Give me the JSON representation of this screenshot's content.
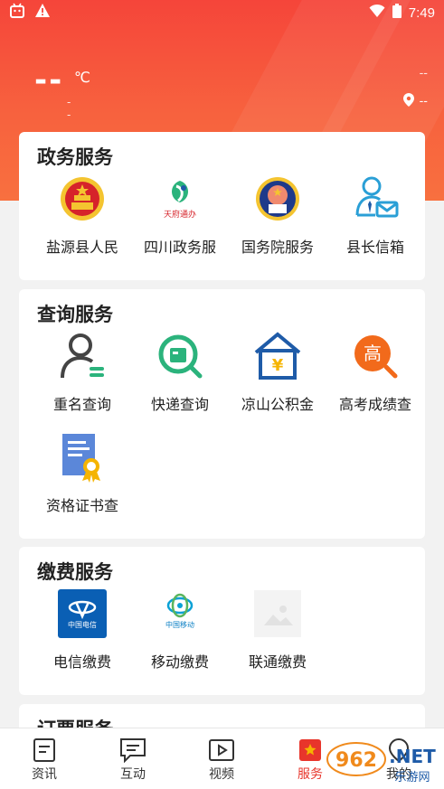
{
  "status_bar": {
    "time": "7:49"
  },
  "weather": {
    "temp": "--",
    "unit": "℃",
    "desc": "--"
  },
  "location": {
    "top": "--",
    "city": "--"
  },
  "sections": [
    {
      "title": "政务服务",
      "items": [
        {
          "label": "盐源县人民",
          "icon": "national-emblem-icon"
        },
        {
          "label": "四川政务服",
          "icon": "tianfu-tongban-icon"
        },
        {
          "label": "国务院服务",
          "icon": "state-council-icon"
        },
        {
          "label": "县长信箱",
          "icon": "mailbox-icon"
        }
      ]
    },
    {
      "title": "查询服务",
      "items": [
        {
          "label": "重名查询",
          "icon": "person-icon"
        },
        {
          "label": "快递查询",
          "icon": "express-icon"
        },
        {
          "label": "凉山公积金",
          "icon": "housing-fund-icon"
        },
        {
          "label": "高考成绩查",
          "icon": "exam-score-icon"
        },
        {
          "label": "资格证书查",
          "icon": "certificate-icon"
        }
      ]
    },
    {
      "title": "缴费服务",
      "items": [
        {
          "label": "电信缴费",
          "icon": "china-telecom-icon"
        },
        {
          "label": "移动缴费",
          "icon": "china-mobile-icon"
        },
        {
          "label": "联通缴费",
          "icon": "image-placeholder-icon"
        }
      ]
    },
    {
      "title": "订票服务",
      "items": []
    }
  ],
  "logos": {
    "tianfu": "天府通办",
    "telecom": "中国电信",
    "mobile": "中国移动",
    "exam": "高",
    "fund": "¥"
  },
  "tabs": [
    {
      "label": "资讯",
      "icon": "news-icon",
      "active": false
    },
    {
      "label": "互动",
      "icon": "chat-icon",
      "active": false
    },
    {
      "label": "视频",
      "icon": "video-icon",
      "active": false
    },
    {
      "label": "服务",
      "icon": "service-icon",
      "active": true
    },
    {
      "label": "我的",
      "icon": "profile-icon",
      "active": false
    }
  ],
  "watermark": {
    "text_big": "962",
    "text_net": ".NET",
    "text_sub": "乐游网"
  },
  "colors": {
    "primary": "#f5453a",
    "active_tab": "#e8352b",
    "telecom_blue": "#0a5fb4",
    "fund_blue": "#1e5ba8",
    "exam_orange": "#f26a1b",
    "express_green": "#2bb37c",
    "cert_blue": "#5b87d9",
    "cert_gold": "#f5b400"
  }
}
